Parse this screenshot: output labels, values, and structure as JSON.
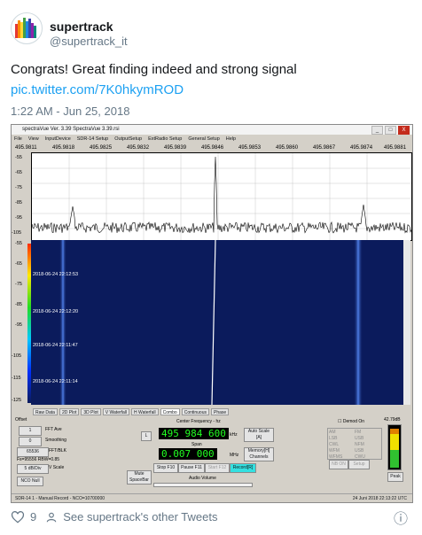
{
  "tweet": {
    "display_name": "supertrack",
    "handle": "@supertrack_it",
    "text": "Congrats!  Great finding indeed and strong signal",
    "link": "pic.twitter.com/7K0hkymROD",
    "time": "1:22 AM - Jun 25, 2018",
    "like_count": "9",
    "see_other": "See supertrack's other Tweets"
  },
  "app": {
    "title": "spectraVue Ver. 3.39  SpectraVue 3.39.rsi",
    "window_buttons": [
      "_",
      "□",
      "X"
    ],
    "menu": [
      "File",
      "View",
      "InputDevice",
      "SDR-14 Setup",
      "OutputSetup",
      "ExtRadio Setup",
      "General Setup",
      "Help"
    ],
    "freq_ticks": [
      "495.9811",
      "495.9818",
      "495.9825",
      "495.9832",
      "495.9839",
      "495.9846",
      "495.9853",
      "495.9860",
      "495.9867",
      "495.9874",
      "495.9881"
    ],
    "spectrum_db": [
      "-55",
      "-65",
      "-75",
      "-85",
      "-95",
      "-105"
    ],
    "waterfall_db": [
      "-55",
      "-65",
      "-75",
      "-85",
      "-95",
      "-105",
      "-115",
      "-125"
    ],
    "timestamps": [
      "2018-06-24 22:12:53",
      "2018-06-24 22:12:20",
      "2018-06-24 22:11:47",
      "2018-06-24 22:11:14"
    ],
    "tabs": [
      "Raw Data",
      "2D Plot",
      "3D Plot",
      "V Waterfall",
      "H Waterfall",
      "Combo",
      "Continuous",
      "Phase"
    ],
    "active_tab": "Combo",
    "controls": {
      "offset_label": "Offset",
      "fft_value": "1",
      "fft_label": "FFT Ave",
      "smoothing_value": "0",
      "smoothing_label": "Smoothing",
      "fft_blk_value": "65536",
      "fft_blk_label": "FFT/BLK",
      "fs_text": "Fs=95556 RBW=0.85",
      "vscale_value": "5 dB/Div",
      "vscale_label": "V Scale",
      "nco_null": "NCO Null",
      "l_button": "L",
      "center_freq_label": "Center Frequency - hz",
      "center_freq": "495 984 600",
      "center_unit": "kHz",
      "span_label": "Span",
      "span_value": "0.007 000",
      "span_unit": "MHz",
      "auto_scale": "Auto Scale [A]",
      "memory_channels": "Memory[H] Channels",
      "mute": "Mute SpaceBar",
      "stop": "Stop F10",
      "pause": "Pause F11",
      "start": "Start F12",
      "record": "Record[R]",
      "audio_volume": "Audio Volume",
      "demod_on": "Demod On",
      "db_value": "42.79dB",
      "peak": "Peak",
      "modes": [
        "AM",
        "FM",
        "LSB",
        "USB",
        "CWL",
        "NFM",
        "WFM",
        "USB",
        "WFMS",
        "CWU"
      ],
      "nb": "NB ON",
      "setup": "Setup"
    },
    "status_left": "SDR-14 1   - Manual Record -   NCO=10700000",
    "status_right": "24 Juni 2018   22:13:22 UTC"
  },
  "colors": {
    "link": "#1da1f2",
    "muted": "#657786",
    "waterfall_bg": "#0b1b5c",
    "lcd": "#22ff22"
  }
}
